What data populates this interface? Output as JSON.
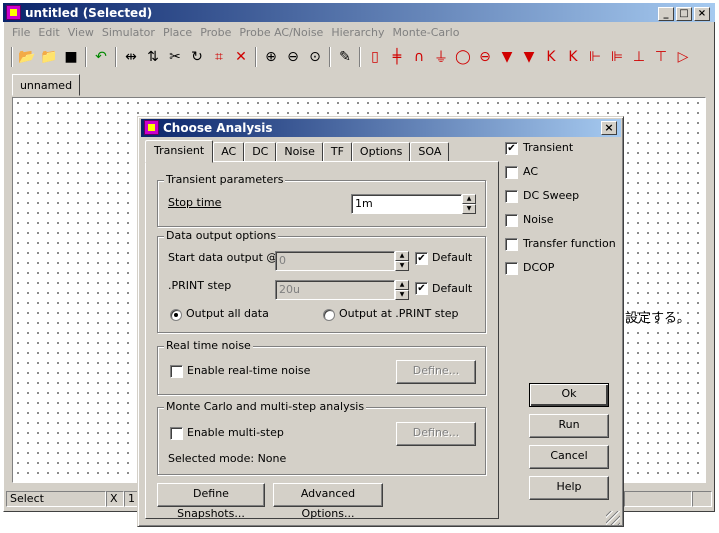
{
  "window": {
    "title": "untitled (Selected)",
    "min": "_",
    "max": "□",
    "close": "×"
  },
  "menu": [
    "File",
    "Edit",
    "View",
    "Simulator",
    "Place",
    "Probe",
    "Probe AC/Noise",
    "Hierarchy",
    "Monte-Carlo"
  ],
  "toolbar_icons": [
    "open-folder-icon",
    "new-folder-icon",
    "save-icon",
    "undo-icon",
    "mirror-h-icon",
    "mirror-v-icon",
    "cut-icon",
    "rotate-icon",
    "delete-wire-icon",
    "delete-icon",
    "zoom-in-icon",
    "zoom-out-icon",
    "zoom-fit-icon",
    "pencil-icon",
    "resistor-icon",
    "capacitor-icon",
    "inductor-icon",
    "ground-icon",
    "voltage-source-icon",
    "current-source-icon",
    "diode-icon",
    "zener-icon",
    "npn-icon",
    "pnp-icon",
    "nmos-icon",
    "pmos-icon",
    "jfet-icon",
    "jfet-p-icon",
    "opamp-icon"
  ],
  "doc_tab": "unnamed",
  "status": {
    "mode": "Select",
    "coord_label": "X",
    "coord_value": "1"
  },
  "background_text": "を設定する。",
  "dialog": {
    "title": "Choose Analysis",
    "close": "×",
    "tabs": [
      "Transient",
      "AC",
      "DC",
      "Noise",
      "TF",
      "Options",
      "SOA"
    ],
    "active_tab": "Transient",
    "transient_group": {
      "label": "Transient parameters",
      "stop_time_label": "Stop time",
      "stop_time_value": "1m"
    },
    "output_group": {
      "label": "Data output options",
      "start_label": "Start data output @",
      "start_value": "0",
      "start_default_label": "Default",
      "start_default_checked": true,
      "print_label": ".PRINT step",
      "print_value": "20u",
      "print_default_label": "Default",
      "print_default_checked": true,
      "radio_all": "Output all data",
      "radio_print": "Output at .PRINT step",
      "selected": "all"
    },
    "noise_group": {
      "label": "Real time noise",
      "enable_label": "Enable real-time noise",
      "enabled": false,
      "define": "Define..."
    },
    "mc_group": {
      "label": "Monte Carlo and multi-step analysis",
      "enable_label": "Enable multi-step",
      "enabled": false,
      "define": "Define...",
      "mode": "Selected mode: None"
    },
    "define_snapshots": "Define Snapshots...",
    "advanced_options": "Advanced Options...",
    "analyses": [
      {
        "label": "Transient",
        "checked": true
      },
      {
        "label": "AC",
        "checked": false
      },
      {
        "label": "DC Sweep",
        "checked": false
      },
      {
        "label": "Noise",
        "checked": false
      },
      {
        "label": "Transfer function",
        "checked": false
      },
      {
        "label": "DCOP",
        "checked": false
      }
    ],
    "buttons": {
      "ok": "Ok",
      "run": "Run",
      "cancel": "Cancel",
      "help": "Help"
    }
  }
}
